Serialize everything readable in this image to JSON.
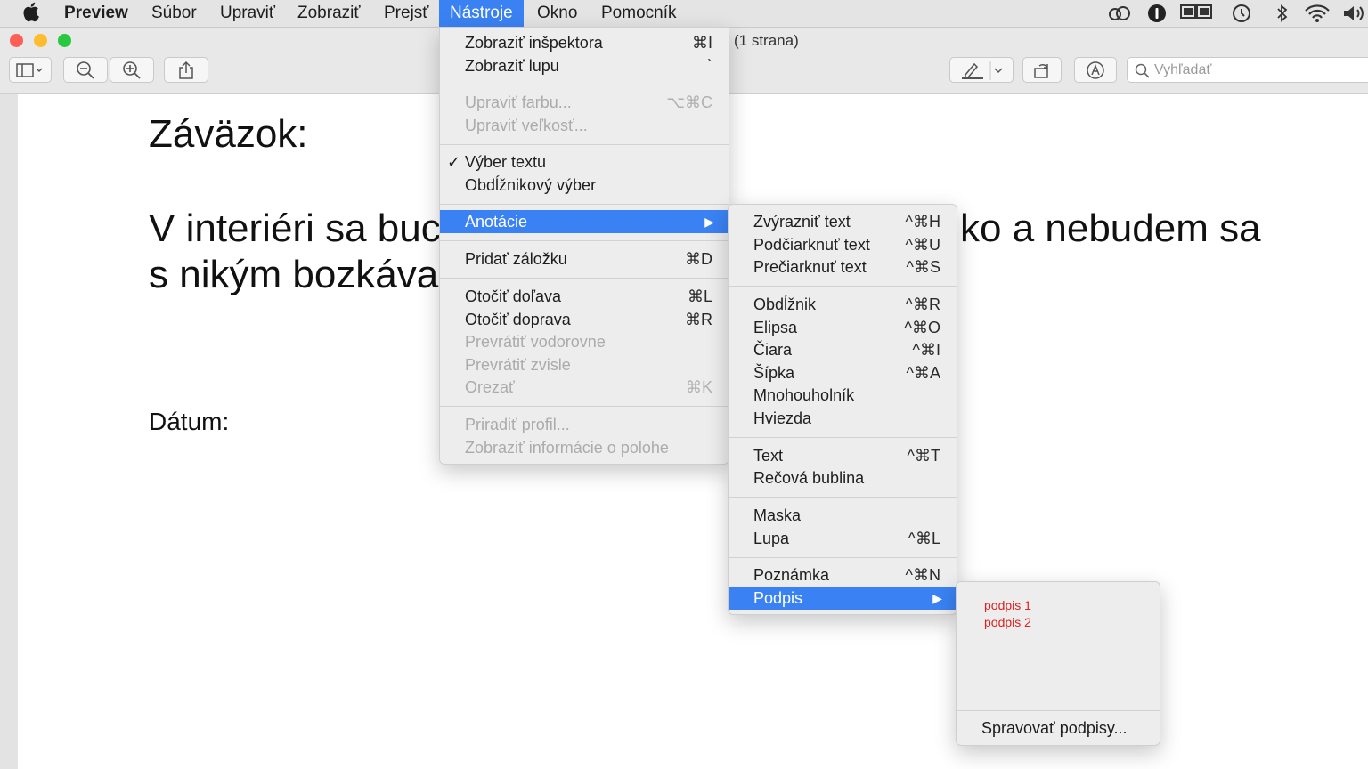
{
  "menubar": {
    "app": "Preview",
    "items": [
      "Súbor",
      "Upraviť",
      "Zobraziť",
      "Prejsť",
      "Nástroje",
      "Okno",
      "Pomocník"
    ],
    "active": "Nástroje"
  },
  "window": {
    "subtitle": "(1 strana)",
    "search_placeholder": "Vyhľadať"
  },
  "document": {
    "heading": "Záväzok:",
    "line1_left": "V interiéri sa buc",
    "line1_right": "ko a nebudem sa",
    "line2_left": "s nikým bozkáva",
    "date_label": "Dátum:"
  },
  "tools_menu": {
    "show_inspector": {
      "label": "Zobraziť inšpektora",
      "shortcut": "⌘I"
    },
    "show_magnifier": {
      "label": "Zobraziť lupu",
      "shortcut": "`"
    },
    "adjust_color": {
      "label": "Upraviť farbu...",
      "shortcut": "⌥⌘C"
    },
    "adjust_size": {
      "label": "Upraviť veľkosť..."
    },
    "text_selection": {
      "label": "Výber textu",
      "check": "✓"
    },
    "rect_selection": {
      "label": "Obdĺžnikový výber"
    },
    "annotations": {
      "label": "Anotácie"
    },
    "add_bookmark": {
      "label": "Pridať záložku",
      "shortcut": "⌘D"
    },
    "rotate_left": {
      "label": "Otočiť doľava",
      "shortcut": "⌘L"
    },
    "rotate_right": {
      "label": "Otočiť doprava",
      "shortcut": "⌘R"
    },
    "flip_horizontal": {
      "label": "Prevrátiť vodorovne"
    },
    "flip_vertical": {
      "label": "Prevrátiť zvisle"
    },
    "crop": {
      "label": "Orezať",
      "shortcut": "⌘K"
    },
    "assign_profile": {
      "label": "Priradiť profil..."
    },
    "show_location": {
      "label": "Zobraziť informácie o polohe"
    }
  },
  "annotations_menu": {
    "highlight": {
      "label": "Zvýrazniť text",
      "shortcut": "^⌘H"
    },
    "underline": {
      "label": "Podčiarknuť text",
      "shortcut": "^⌘U"
    },
    "strikethrough": {
      "label": "Prečiarknuť text",
      "shortcut": "^⌘S"
    },
    "rectangle": {
      "label": "Obdĺžnik",
      "shortcut": "^⌘R"
    },
    "ellipse": {
      "label": "Elipsa",
      "shortcut": "^⌘O"
    },
    "line": {
      "label": "Čiara",
      "shortcut": "^⌘I"
    },
    "arrow": {
      "label": "Šípka",
      "shortcut": "^⌘A"
    },
    "polygon": {
      "label": "Mnohouholník"
    },
    "star": {
      "label": "Hviezda"
    },
    "text": {
      "label": "Text",
      "shortcut": "^⌘T"
    },
    "speech_bubble": {
      "label": "Rečová bublina"
    },
    "mask": {
      "label": "Maska"
    },
    "loupe": {
      "label": "Lupa",
      "shortcut": "^⌘L"
    },
    "note": {
      "label": "Poznámka",
      "shortcut": "^⌘N"
    },
    "signature": {
      "label": "Podpis"
    }
  },
  "signature_menu": {
    "signatures": [
      "podpis 1",
      "podpis 2"
    ],
    "manage": "Spravovať podpisy..."
  },
  "colors": {
    "accent": "#3a82f3",
    "signature_ink": "#e02020",
    "close": "#fe5f57",
    "minimize": "#febc2e",
    "zoom": "#28c840"
  }
}
